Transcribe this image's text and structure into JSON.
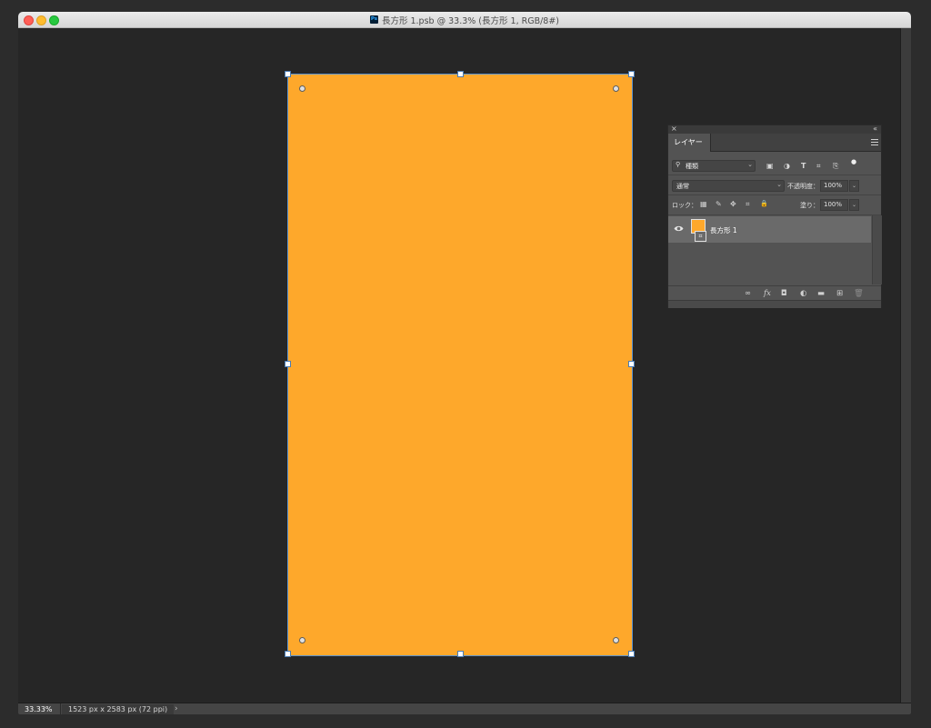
{
  "window": {
    "title": "長方形 1.psb @ 33.3% (長方形 1, RGB/8#)",
    "app_badge": "Ps"
  },
  "canvas": {
    "fill_color": "#fea82b",
    "background": "#262626"
  },
  "status_bar": {
    "zoom": "33.33%",
    "doc_info": "1523 px x 2583 px (72 ppi)",
    "arrow": "›"
  },
  "layers_panel": {
    "close_glyph": "×",
    "collapse_glyph": "«",
    "tab_label": "レイヤー",
    "filter": {
      "search_glyph": "⚲",
      "label": "種類",
      "chevron": "⌄"
    },
    "blend_mode": {
      "label": "通常",
      "chevron": "⌄"
    },
    "opacity": {
      "label": "不透明度：",
      "value": "100%",
      "chevron": "⌄"
    },
    "lock_label": "ロック：",
    "fill": {
      "label": "塗り：",
      "value": "100%",
      "chevron": "⌄"
    },
    "filter_icons": [
      "▣",
      "◑",
      "T",
      "⌗",
      "⎘",
      "●"
    ],
    "lock_icons": [
      "▦",
      "✎",
      "✥",
      "⌗",
      "🔒"
    ],
    "layers": [
      {
        "name": "長方形 1",
        "badge": "⌗"
      }
    ],
    "bottom_icons": [
      "∞",
      "fx",
      "◘",
      "◐",
      "▬",
      "⊞",
      "🗑"
    ]
  }
}
